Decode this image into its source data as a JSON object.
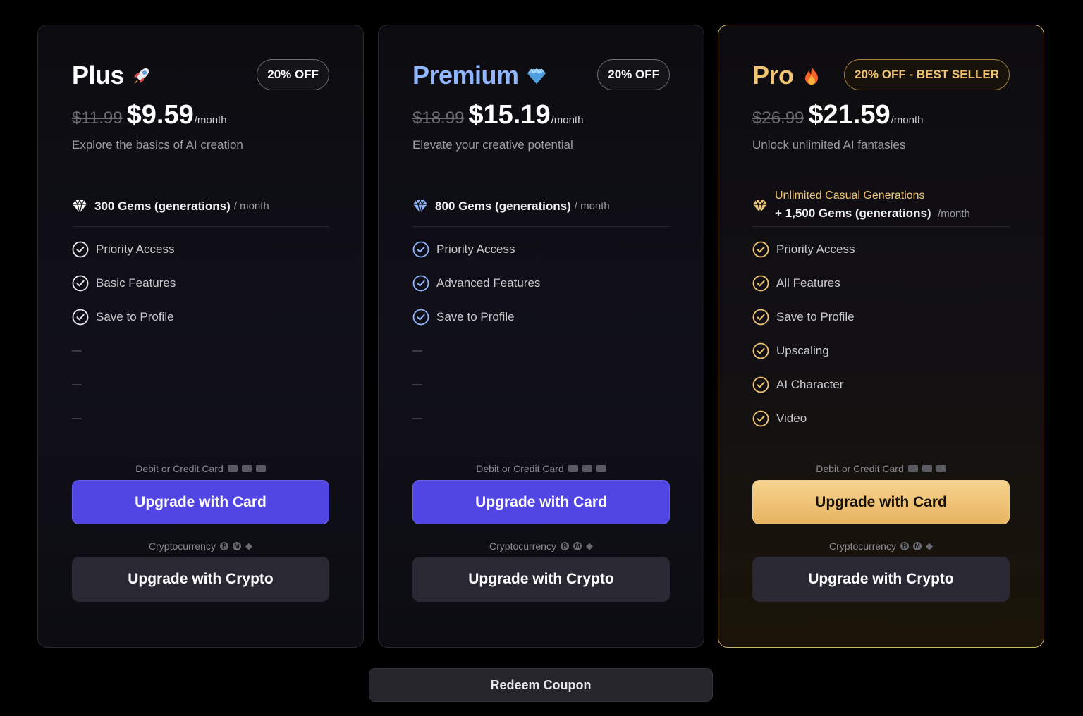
{
  "colors": {
    "background": "#000000",
    "premium_accent": "#8fb6ff",
    "pro_accent": "#f0c470",
    "card_button": "#5146e4",
    "pro_button": "#e7b460",
    "crypto_button": "#2a2833"
  },
  "plans": [
    {
      "name": "Plus",
      "emoji_icon": "rocket-icon",
      "badge": "20% OFF",
      "old_price": "$11.99",
      "price": "$9.59",
      "per": "/month",
      "tagline": "Explore the basics of AI creation",
      "gems_text": "300 Gems (generations)",
      "gems_unit": "/ month",
      "features": [
        "Priority Access",
        "Basic Features",
        "Save to Profile"
      ],
      "empty_slots": 3,
      "card_label": "Debit or Credit Card",
      "card_button": "Upgrade with Card",
      "crypto_label": "Cryptocurrency",
      "crypto_button": "Upgrade with Crypto"
    },
    {
      "name": "Premium",
      "emoji_icon": "diamond-icon",
      "badge": "20% OFF",
      "old_price": "$18.99",
      "price": "$15.19",
      "per": "/month",
      "tagline": "Elevate your creative potential",
      "gems_text": "800 Gems (generations)",
      "gems_unit": "/ month",
      "features": [
        "Priority Access",
        "Advanced Features",
        "Save to Profile"
      ],
      "empty_slots": 3,
      "card_label": "Debit or Credit Card",
      "card_button": "Upgrade with Card",
      "crypto_label": "Cryptocurrency",
      "crypto_button": "Upgrade with Crypto"
    },
    {
      "name": "Pro",
      "emoji_icon": "fire-icon",
      "badge": "20% OFF - BEST SELLER",
      "old_price": "$26.99",
      "price": "$21.59",
      "per": "/month",
      "tagline": "Unlock unlimited AI fantasies",
      "unlimited_text": "Unlimited Casual Generations",
      "gems_text": "+ 1,500 Gems (generations)",
      "gems_unit": "/month",
      "features": [
        "Priority Access",
        "All Features",
        "Save to Profile",
        "Upscaling",
        "AI Character",
        "Video"
      ],
      "empty_slots": 0,
      "card_label": "Debit or Credit Card",
      "card_button": "Upgrade with Card",
      "crypto_label": "Cryptocurrency",
      "crypto_button": "Upgrade with Crypto"
    }
  ],
  "coupon_button": "Redeem Coupon"
}
